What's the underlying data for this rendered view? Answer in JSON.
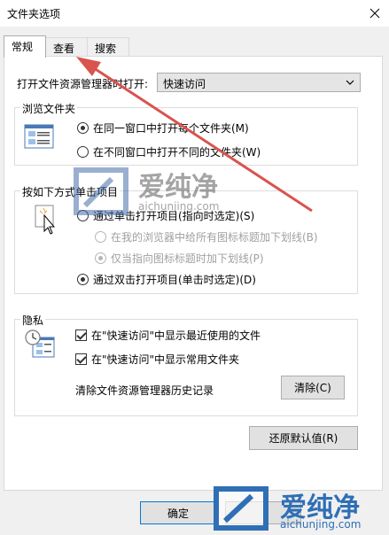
{
  "window": {
    "title": "文件夹选项"
  },
  "tabs": [
    {
      "label": "常规",
      "active": true
    },
    {
      "label": "查看",
      "active": false
    },
    {
      "label": "搜索",
      "active": false
    }
  ],
  "general": {
    "open_explorer_label": "打开文件资源管理器时打开:",
    "open_explorer_value": "快速访问",
    "browse_group": {
      "title": "浏览文件夹",
      "options": [
        {
          "label": "在同一窗口中打开每个文件夹(M)",
          "checked": true
        },
        {
          "label": "在不同窗口中打开不同的文件夹(W)",
          "checked": false
        }
      ]
    },
    "click_group": {
      "title": "按如下方式单击项目",
      "single_click": {
        "label": "通过单击打开项目(指向时选定)(S)",
        "checked": false
      },
      "underline_browser": {
        "label": "在我的浏览器中给所有图标标题加下划线(B)",
        "checked": false
      },
      "underline_hover": {
        "label": "仅当指向图标标题时加下划线(P)",
        "checked": true
      },
      "double_click": {
        "label": "通过双击打开项目(单击时选定)(D)",
        "checked": true
      }
    },
    "privacy_group": {
      "title": "隐私",
      "show_recent": {
        "label": "在\"快速访问\"中显示最近使用的文件",
        "checked": true
      },
      "show_frequent": {
        "label": "在\"快速访问\"中显示常用文件夹",
        "checked": true
      },
      "clear_history_label": "清除文件资源管理器历史记录",
      "clear_button": "清除(C)"
    },
    "restore_defaults_button": "还原默认值(R)"
  },
  "footer": {
    "ok_button": "确定"
  },
  "watermarks": {
    "center_brand": "爱纯净",
    "center_url": "aichunjing.com",
    "corner_brand": "爱纯净",
    "corner_url": "aichunjing.com"
  },
  "colors": {
    "arrow": "#d9534f",
    "accent": "#0078d7"
  }
}
